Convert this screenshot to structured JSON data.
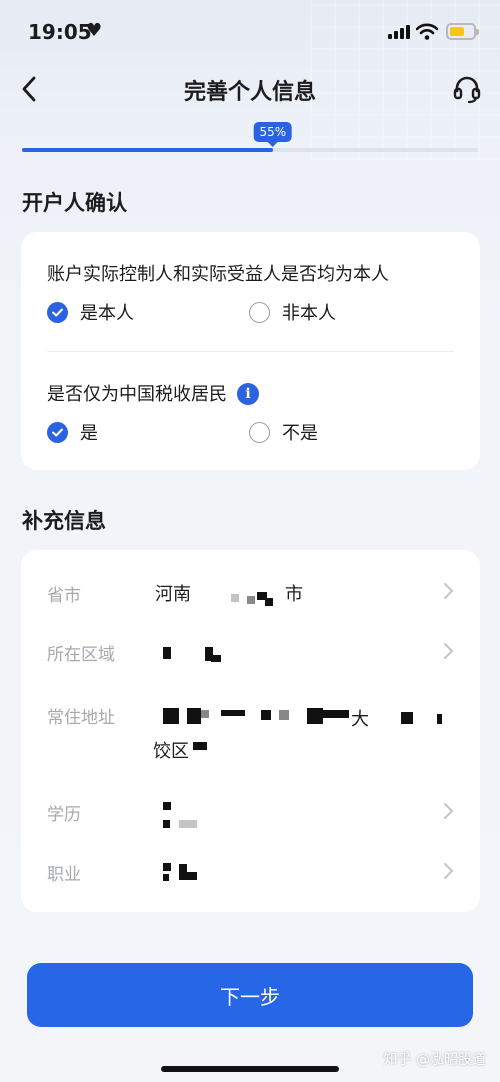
{
  "status_bar": {
    "time": "19:05",
    "heart": "♥",
    "battery_color": "#f5c812"
  },
  "nav": {
    "back_icon": "chevron-left-icon",
    "title": "完善个人信息",
    "service_icon": "headset-icon"
  },
  "progress": {
    "label": "55%",
    "value": 0.55
  },
  "section_account": {
    "title": "开户人确认"
  },
  "question_beneficiary": {
    "text": "账户实际控制人和实际受益人是否均为本人",
    "options": [
      {
        "label": "是本人",
        "selected": true
      },
      {
        "label": "非本人",
        "selected": false
      }
    ]
  },
  "question_tax": {
    "text": "是否仅为中国税收居民",
    "info_icon": "i",
    "options": [
      {
        "label": "是",
        "selected": true
      },
      {
        "label": "不是",
        "selected": false
      }
    ]
  },
  "section_supplement": {
    "title": "补充信息"
  },
  "fields": [
    {
      "label": "省市",
      "value": "河南",
      "value_tail": "市"
    },
    {
      "label": "所在区域"
    },
    {
      "label": "常住地址",
      "value_part": "大",
      "value_line2": "饺区"
    },
    {
      "label": "学历"
    },
    {
      "label": "职业"
    }
  ],
  "next_button": {
    "label": "下一步"
  },
  "watermark": "知乎 @泓昭股道",
  "colors": {
    "accent": "#2a62e0",
    "button": "#2766e6"
  }
}
